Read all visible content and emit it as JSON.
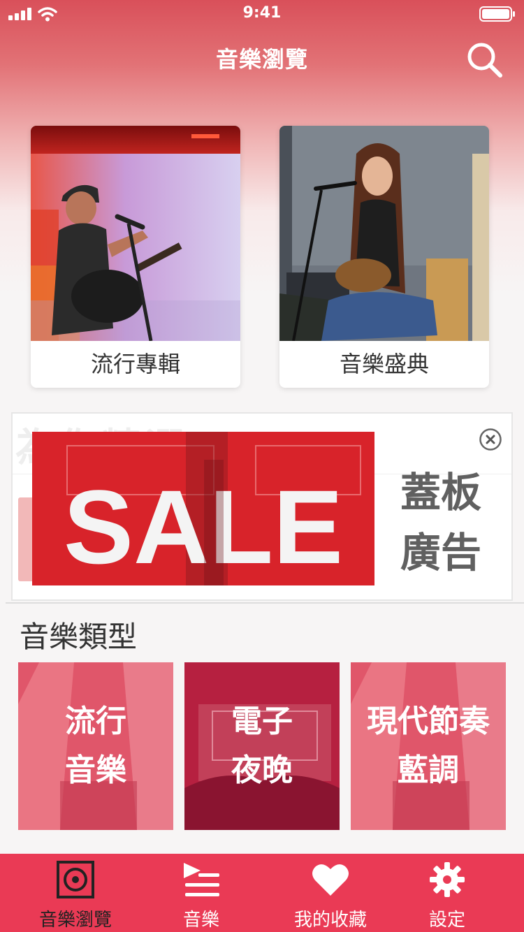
{
  "status_bar": {
    "time": "9:41"
  },
  "header": {
    "title": "音樂瀏覽",
    "search_icon": "search-icon"
  },
  "albums": [
    {
      "label": "流行專輯"
    },
    {
      "label": "音樂盛典"
    }
  ],
  "ad": {
    "background_heading": "為你精選",
    "image_text": "SALE",
    "title_line1": "蓋板",
    "title_line2": "廣告",
    "close_icon": "close-circle-icon"
  },
  "genres_section": {
    "title": "音樂類型",
    "items": [
      {
        "line1": "流行",
        "line2": "音樂"
      },
      {
        "line1": "電子",
        "line2": "夜晚"
      },
      {
        "line1": "現代節奏",
        "line2": "藍調"
      }
    ]
  },
  "tabs": [
    {
      "label": "音樂瀏覽",
      "icon": "speaker-icon",
      "active": true
    },
    {
      "label": "音樂",
      "icon": "playlist-icon",
      "active": false
    },
    {
      "label": "我的收藏",
      "icon": "heart-icon",
      "active": false
    },
    {
      "label": "設定",
      "icon": "gear-icon",
      "active": false
    }
  ],
  "colors": {
    "header_gradient_top": "#d9505a",
    "tab_bar": "#ea3a55",
    "active_tab": "#222222",
    "ad_red": "#d8232a"
  }
}
